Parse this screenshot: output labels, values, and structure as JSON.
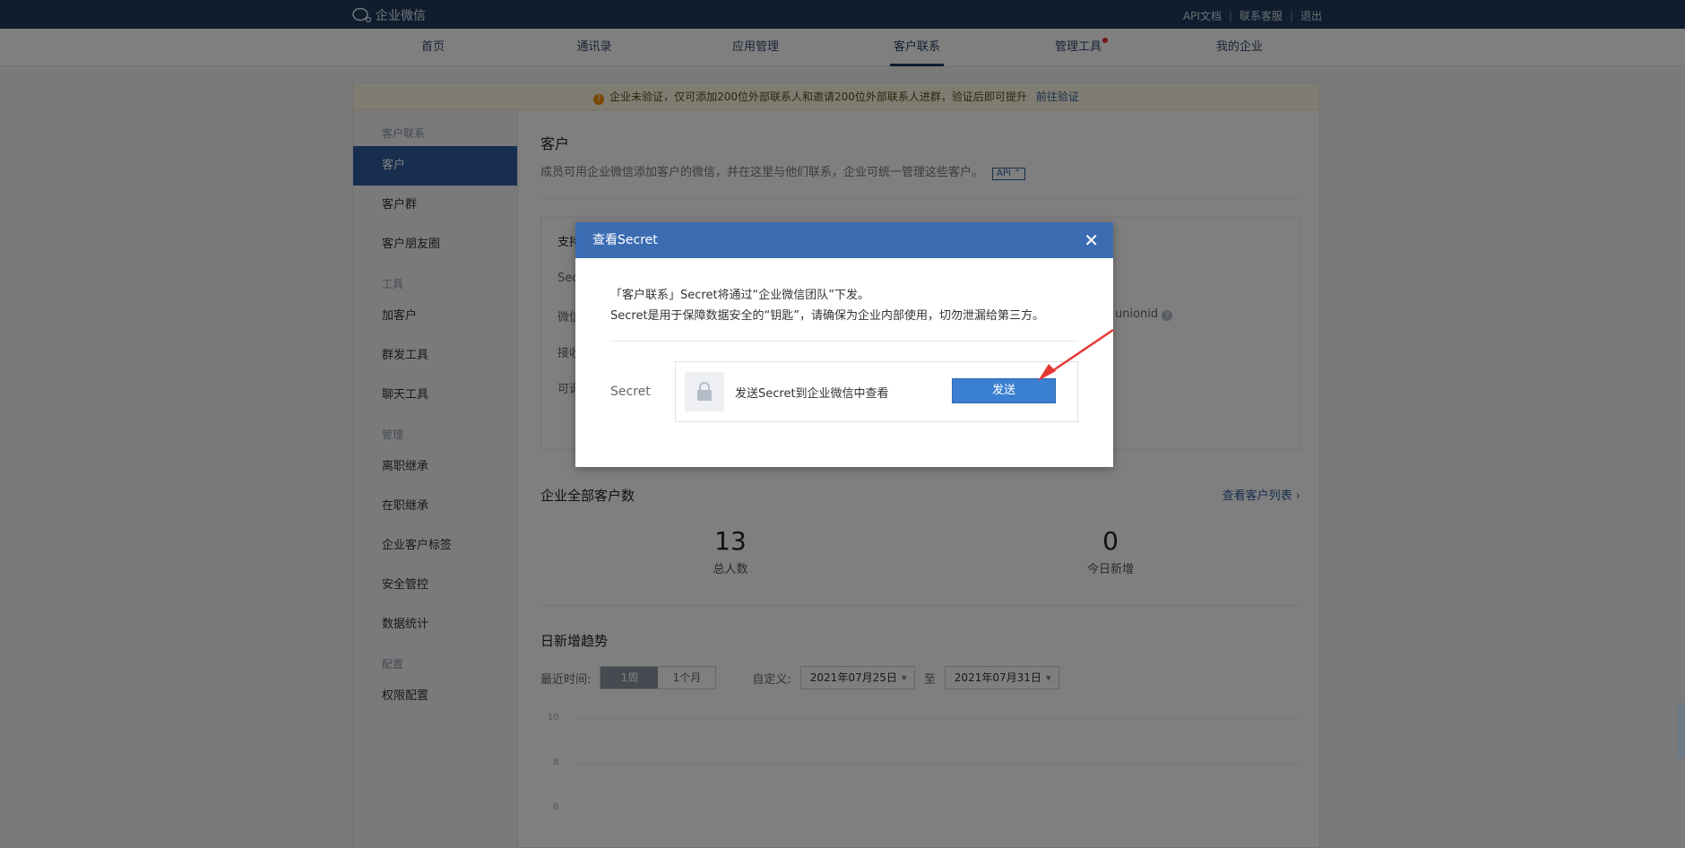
{
  "app": {
    "logo_text": "企业微信"
  },
  "top_links": [
    "API文档",
    "联系客服",
    "退出"
  ],
  "nav": {
    "items": [
      "首页",
      "通讯录",
      "应用管理",
      "客户联系",
      "管理工具",
      "我的企业"
    ],
    "active_index": 3
  },
  "notice": {
    "text": "企业未验证，仅可添加200位外部联系人和邀请200位外部联系人进群，验证后即可提升",
    "link": "前往验证"
  },
  "sidebar": {
    "groups": [
      {
        "title": "客户联系",
        "items": [
          "客户",
          "客户群",
          "客户朋友圈"
        ]
      },
      {
        "title": "工具",
        "items": [
          "加客户",
          "群发工具",
          "聊天工具"
        ]
      },
      {
        "title": "管理",
        "items": [
          "离职继承",
          "在职继承",
          "企业客户标签",
          "安全管控",
          "数据统计"
        ]
      },
      {
        "title": "配置",
        "items": [
          "权限配置"
        ]
      }
    ],
    "active": "客户"
  },
  "content": {
    "title": "客户",
    "desc": "成员可用企业微信添加客户的微信，并在这里与他们联系，企业可统一管理这些客户。",
    "api_tag": "API",
    "box_rows": [
      "支持",
      "Sec",
      "微信",
      "接收",
      "可调"
    ],
    "box_partial": "unionid",
    "stats_title": "企业全部客户数",
    "stats_link": "查看客户列表",
    "stats": [
      {
        "value": "13",
        "label": "总人数"
      },
      {
        "value": "0",
        "label": "今日新增"
      }
    ],
    "trend_title": "日新增趋势",
    "filter_label": "最近时间:",
    "ranges": [
      "1周",
      "1个月"
    ],
    "custom_label": "自定义:",
    "date_from": "2021年07月25日",
    "to_label": "至",
    "date_to": "2021年07月31日",
    "y_ticks": [
      "10",
      "8",
      "6"
    ]
  },
  "dialog": {
    "title": "查看Secret",
    "line1": "「客户联系」Secret将通过“企业微信团队”下发。",
    "line2": "Secret是用于保障数据安全的“钥匙”，请确保为企业内部使用，切勿泄漏给第三方。",
    "secret_label": "Secret",
    "secret_hint": "发送Secret到企业微信中查看",
    "send_label": "发送"
  }
}
